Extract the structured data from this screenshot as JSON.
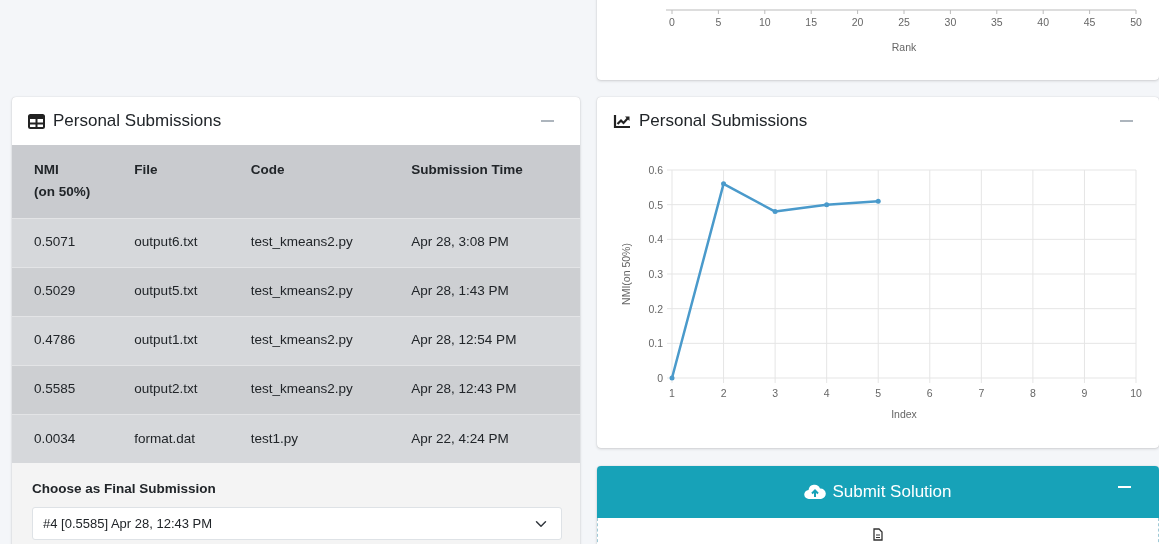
{
  "rank_axis": {
    "label": "Rank",
    "ticks": [
      "0",
      "5",
      "10",
      "15",
      "20",
      "25",
      "30",
      "35",
      "40",
      "45",
      "50"
    ]
  },
  "submissions_table": {
    "title": "Personal Submissions",
    "columns": [
      "NMI\n(on 50%)",
      "File",
      "Code",
      "Submission Time"
    ],
    "rows": [
      [
        "0.5071",
        "output6.txt",
        "test_kmeans2.py",
        "Apr 28, 3:08 PM"
      ],
      [
        "0.5029",
        "output5.txt",
        "test_kmeans2.py",
        "Apr 28, 1:43 PM"
      ],
      [
        "0.4786",
        "output1.txt",
        "test_kmeans2.py",
        "Apr 28, 12:54 PM"
      ],
      [
        "0.5585",
        "output2.txt",
        "test_kmeans2.py",
        "Apr 28, 12:43 PM"
      ],
      [
        "0.0034",
        "format.dat",
        "test1.py",
        "Apr 22, 4:24 PM"
      ]
    ],
    "final_submission": {
      "label": "Choose as Final Submission",
      "value": "#4 [0.5585] Apr 28, 12:43 PM"
    }
  },
  "submissions_chart": {
    "title": "Personal Submissions",
    "chart_data": {
      "type": "line",
      "grid": true,
      "xlabel": "Index",
      "ylabel": "NMI(on 50%)",
      "x": [
        1,
        2,
        3,
        4,
        5
      ],
      "series": [
        {
          "color": "#4a9acb",
          "values": [
            0.0,
            0.56,
            0.48,
            0.5,
            0.51
          ]
        }
      ],
      "xlim": [
        1,
        10
      ],
      "ylim": [
        0,
        0.6
      ],
      "xticks": [
        1,
        2,
        3,
        4,
        5,
        6,
        7,
        8,
        9,
        10
      ],
      "yticks": [
        0,
        0.1,
        0.2,
        0.3,
        0.4,
        0.5,
        0.6
      ]
    }
  },
  "submit_panel": {
    "title": "Submit Solution"
  }
}
